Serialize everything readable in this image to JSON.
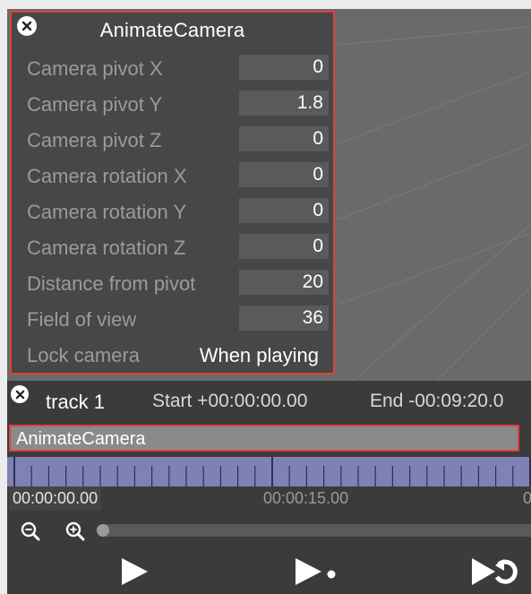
{
  "panel": {
    "title": "AnimateCamera",
    "rows": [
      {
        "label": "Camera pivot X",
        "value": "0"
      },
      {
        "label": "Camera pivot Y",
        "value": "1.8"
      },
      {
        "label": "Camera pivot Z",
        "value": "0"
      },
      {
        "label": "Camera rotation X",
        "value": "0"
      },
      {
        "label": "Camera rotation Y",
        "value": "0"
      },
      {
        "label": "Camera rotation Z",
        "value": "0"
      },
      {
        "label": "Distance from pivot",
        "value": "20"
      },
      {
        "label": "Field of view",
        "value": "36"
      }
    ],
    "lock_camera_label": "Lock camera",
    "lock_camera_value": "When playing"
  },
  "track": {
    "name": "track 1",
    "start": "Start +00:00:00.00",
    "end": "End -00:09:20.0"
  },
  "clip": {
    "label": "AnimateCamera"
  },
  "timeline": {
    "time_start": "00:00:00.00",
    "time_mid": "00:00:15.00",
    "time_end": "0"
  },
  "colors": {
    "highlight": "#e0413a",
    "ruler": "#7f80b3",
    "panel_bg": "#474747",
    "timeline_bg": "#3b3b3b"
  },
  "icons": {
    "close": "close-icon",
    "zoom_out": "zoom-out-icon",
    "zoom_in": "zoom-in-icon",
    "play": "play-icon",
    "play_from": "play-from-icon",
    "loop": "loop-icon"
  }
}
